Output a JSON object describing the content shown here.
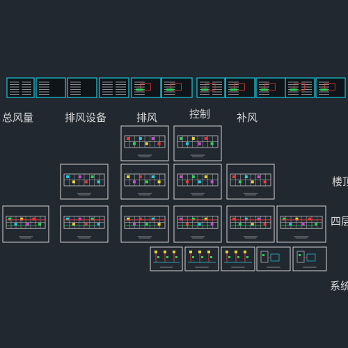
{
  "labels": {
    "total_air": "总风量",
    "exhaust_equipment": "排风设备",
    "exhaust": "排风",
    "control": "控制",
    "supply": "补风",
    "roof": "楼顶",
    "fourth_floor": "四层",
    "system": "系统"
  },
  "colors": {
    "background": "#212830",
    "sheet_frame": "#e6e6e6",
    "title_frame": "#19c6d6",
    "plan_wall": "#c8c8c8",
    "accent_red": "#e23b3b",
    "accent_green": "#2fd05a",
    "accent_cyan": "#28c9e0",
    "accent_yellow": "#e8d23a",
    "accent_magenta": "#d04ad0",
    "label_text": "#d8d8d8"
  }
}
